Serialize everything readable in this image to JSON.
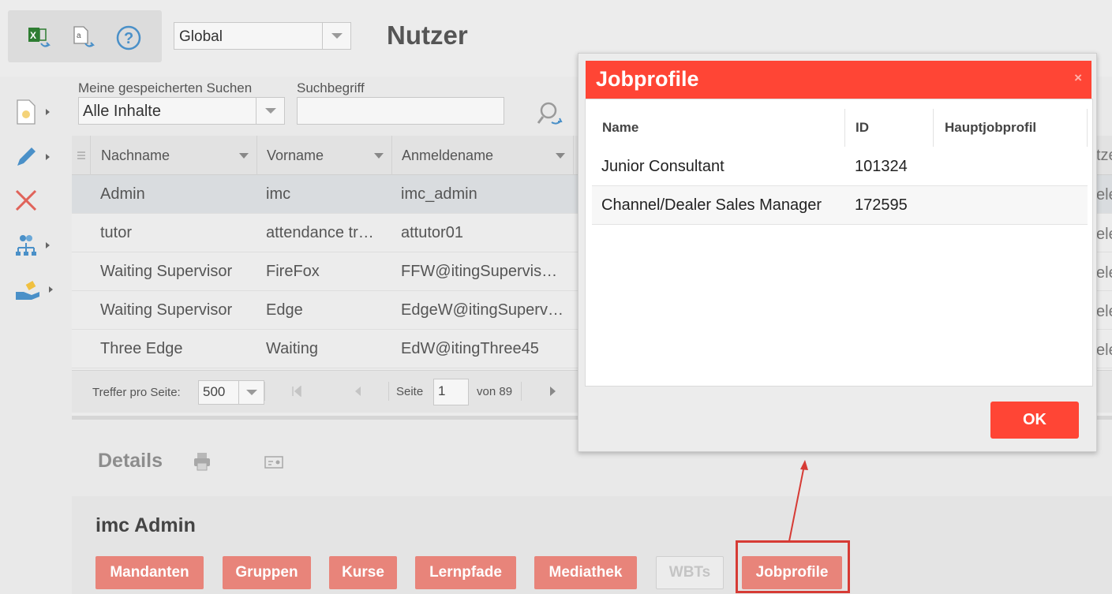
{
  "toolbar": {
    "icons": [
      "excel-export-icon",
      "text-export-icon",
      "help-icon"
    ],
    "global_select": "Global",
    "page_title": "Nutzer"
  },
  "sidebar": {
    "items": [
      "new-document-icon",
      "edit-icon",
      "delete-icon",
      "hierarchy-icon",
      "handover-icon"
    ]
  },
  "search": {
    "saved_label": "Meine gespeicherten Suchen",
    "saved_value": "Alle Inhalte",
    "term_label": "Suchbegriff",
    "term_value": ""
  },
  "grid": {
    "columns": [
      "Nachname",
      "Vorname",
      "Anmeldename"
    ],
    "partial_header": "tze",
    "rows": [
      {
        "nachname": "Admin",
        "vorname": "imc",
        "anmeldename": "imc_admin",
        "partial": "ele"
      },
      {
        "nachname": "tutor",
        "vorname": "attendance tr…",
        "anmeldename": "attutor01",
        "partial": "ele"
      },
      {
        "nachname": "Waiting Supervisor",
        "vorname": "FireFox",
        "anmeldename": "FFW@itingSupervis…",
        "partial": "ele"
      },
      {
        "nachname": "Waiting Supervisor",
        "vorname": "Edge",
        "anmeldename": "EdgeW@itingSuperv…",
        "partial": "ele"
      },
      {
        "nachname": "Three Edge",
        "vorname": "Waiting",
        "anmeldename": "EdW@itingThree45",
        "partial": "ele"
      }
    ],
    "pager": {
      "per_page_label": "Treffer pro Seite:",
      "per_page_value": "500",
      "page_label": "Seite",
      "page_value": "1",
      "of_label": "von 89"
    }
  },
  "details": {
    "title": "Details",
    "person_name": "imc Admin",
    "buttons": [
      "Mandanten",
      "Gruppen",
      "Kurse",
      "Lernpfade",
      "Mediathek",
      "WBTs",
      "Jobprofile"
    ]
  },
  "modal": {
    "title": "Jobprofile",
    "close": "×",
    "columns": [
      "Name",
      "ID",
      "Hauptjobprofil"
    ],
    "rows": [
      {
        "name": "Junior Consultant",
        "id": "101324",
        "main": ""
      },
      {
        "name": "Channel/Dealer Sales Manager",
        "id": "172595",
        "main": ""
      }
    ],
    "ok_label": "OK"
  },
  "colors": {
    "accent": "#ff4535",
    "button_muted": "#e8847a",
    "highlight_border": "#d63b35"
  }
}
